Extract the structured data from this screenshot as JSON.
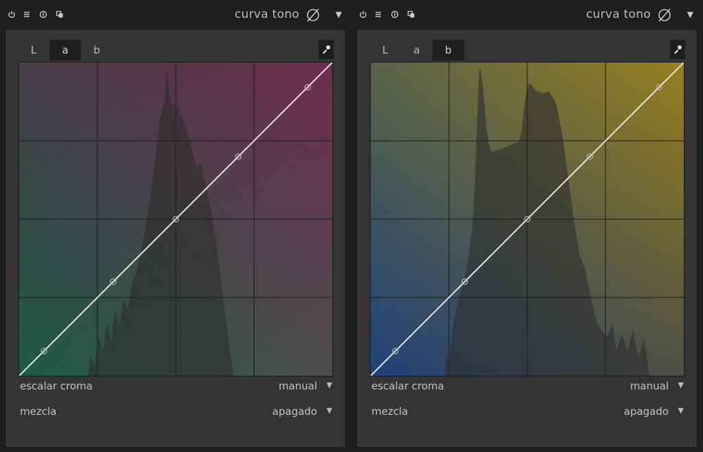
{
  "modules": [
    {
      "title": "curva tono",
      "tabs": [
        "L",
        "a",
        "b"
      ],
      "active_tab": 1,
      "colors": {
        "bl": "#1d5a46",
        "tr": "#6e2c4c",
        "tl": "#463d48",
        "br": "#4d4d4d"
      },
      "settings": [
        {
          "label": "escalar croma",
          "value": "manual"
        },
        {
          "label": "mezcla",
          "value": "apagado"
        }
      ]
    },
    {
      "title": "curva tono",
      "tabs": [
        "L",
        "a",
        "b"
      ],
      "active_tab": 2,
      "colors": {
        "bl": "#20427a",
        "tr": "#957f20",
        "tl": "#5a6348",
        "br": "#4f5045"
      },
      "settings": [
        {
          "label": "escalar croma",
          "value": "manual"
        },
        {
          "label": "mezcla",
          "value": "apagado"
        }
      ]
    }
  ]
}
